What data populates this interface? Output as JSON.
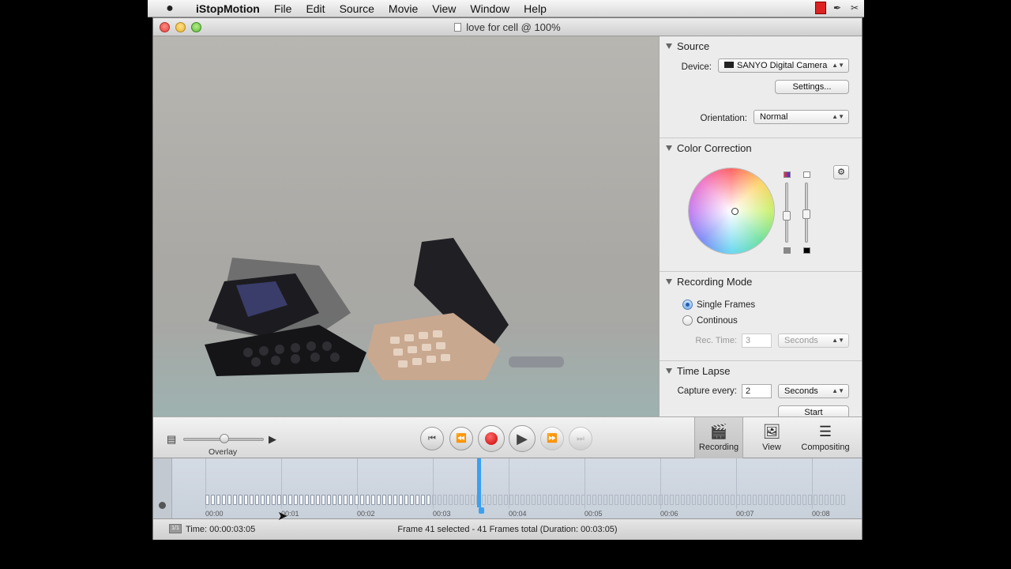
{
  "menubar": {
    "apple": "",
    "items": [
      "iStopMotion",
      "File",
      "Edit",
      "Source",
      "Movie",
      "View",
      "Window",
      "Help"
    ]
  },
  "window": {
    "title": "love for cell @ 100%"
  },
  "inspector": {
    "source": {
      "header": "Source",
      "device_label": "Device:",
      "device_value": "SANYO Digital Camera",
      "settings_button": "Settings...",
      "orientation_label": "Orientation:",
      "orientation_value": "Normal"
    },
    "color_correction": {
      "header": "Color Correction"
    },
    "recording_mode": {
      "header": "Recording Mode",
      "single_frames": "Single Frames",
      "continous": "Continous",
      "selected": "Single Frames",
      "rec_time_label": "Rec. Time:",
      "rec_time_value": "3",
      "rec_time_unit": "Seconds"
    },
    "time_lapse": {
      "header": "Time Lapse",
      "capture_label": "Capture every:",
      "capture_value": "2",
      "capture_unit": "Seconds",
      "start_button": "Start"
    }
  },
  "controls": {
    "overlay_label": "Overlay",
    "overlay_level": 0.5,
    "tabs": [
      {
        "label": "Recording",
        "active": true
      },
      {
        "label": "View",
        "active": false
      },
      {
        "label": "Compositing",
        "active": false
      }
    ]
  },
  "timeline": {
    "tick_labels": [
      "00:00",
      "00:01",
      "00:02",
      "00:03",
      "00:04",
      "00:05",
      "00:06",
      "00:07",
      "00:08"
    ],
    "frames_total": 41,
    "selected_frame": 41
  },
  "status": {
    "time": "Time: 00:00:03:05",
    "frame_info": "Frame 41 selected - 41 Frames total (Duration: 00:03:05)"
  }
}
